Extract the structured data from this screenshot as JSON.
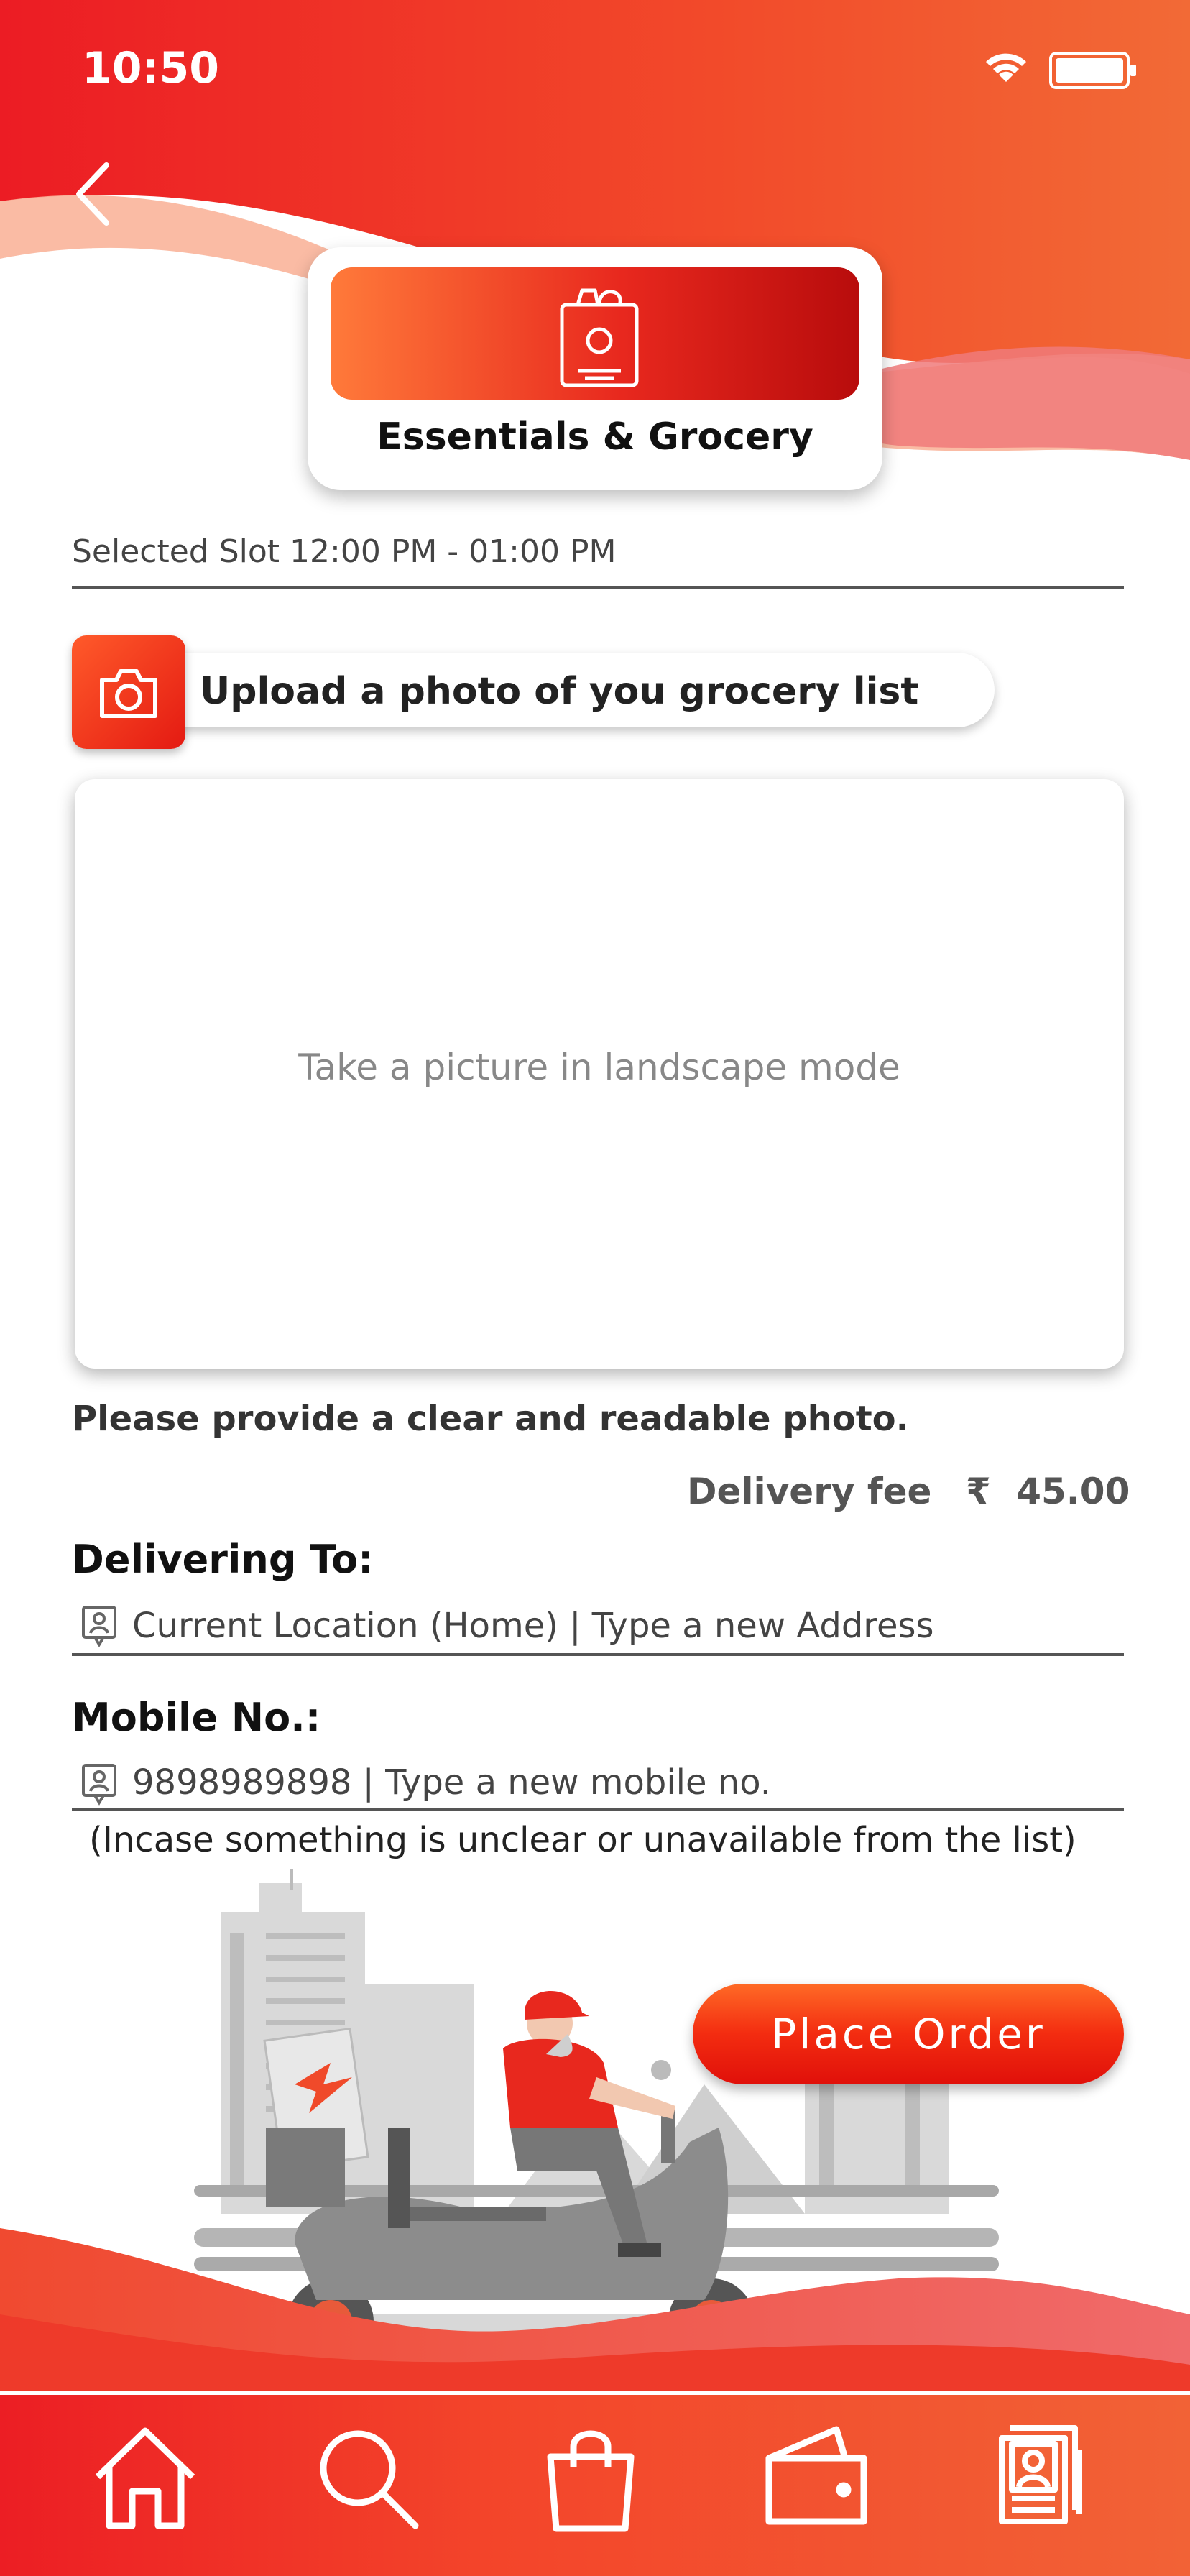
{
  "status_bar": {
    "time": "10:50",
    "icons": [
      "wifi-icon",
      "battery-icon"
    ]
  },
  "header": {
    "back_icon": "chevron-left-icon"
  },
  "category": {
    "title": "Essentials & Grocery",
    "icon": "grocery-bag-icon"
  },
  "slot": {
    "text": "Selected Slot 12:00 PM - 01:00 PM"
  },
  "upload": {
    "label": "Upload a photo of you grocery list",
    "icon": "camera-icon"
  },
  "photo_area": {
    "hint": "Take a picture in landscape mode"
  },
  "helper": "Please provide a clear and readable photo.",
  "delivery_fee": {
    "label": "Delivery fee",
    "currency": "₹",
    "amount": "45.00"
  },
  "delivering_to": {
    "label": "Delivering To:",
    "value": "Current Location (Home) | Type a new Address"
  },
  "mobile": {
    "label": "Mobile No.:",
    "value": "9898989898 | Type a new mobile no.",
    "note": "(Incase something is unclear or unavailable from the list)"
  },
  "order_button": {
    "label": "Place Order"
  },
  "nav": [
    {
      "name": "home",
      "icon": "home-icon"
    },
    {
      "name": "search",
      "icon": "search-icon"
    },
    {
      "name": "bag",
      "icon": "shopping-bag-icon"
    },
    {
      "name": "wallet",
      "icon": "wallet-icon"
    },
    {
      "name": "profile",
      "icon": "profile-card-icon"
    }
  ],
  "colors": {
    "primary": "#EE2A24",
    "accent": "#F26236",
    "text_dark": "#111111"
  }
}
